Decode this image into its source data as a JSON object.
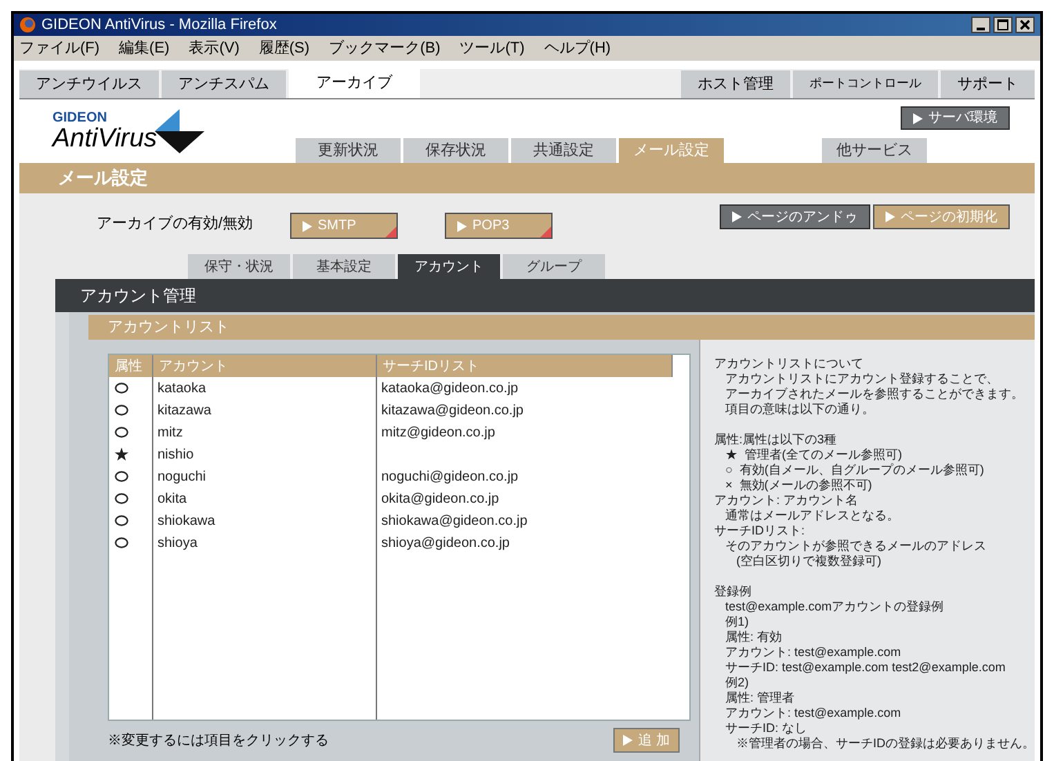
{
  "window": {
    "title": "GIDEON AntiVirus - Mozilla Firefox"
  },
  "menu": [
    "ファイル(F)",
    "編集(E)",
    "表示(V)",
    "履歴(S)",
    "ブックマーク(B)",
    "ツール(T)",
    "ヘルプ(H)"
  ],
  "top_tabs_left": [
    {
      "label": "アンチウイルス",
      "selected": false
    },
    {
      "label": "アンチスパム",
      "selected": false
    },
    {
      "label": "アーカイブ",
      "selected": true
    }
  ],
  "top_tabs_right": [
    {
      "label": "ホスト管理",
      "selected": false
    },
    {
      "label": "ポートコントロール",
      "selected": false
    },
    {
      "label": "サポート",
      "selected": false
    }
  ],
  "logo": {
    "brand": "GIDEON",
    "product": "AntiVirus"
  },
  "server_button": "サーバ環境",
  "nav_tabs": [
    {
      "label": "更新状況",
      "selected": false
    },
    {
      "label": "保存状況",
      "selected": false
    },
    {
      "label": "共通設定",
      "selected": false
    },
    {
      "label": "メール設定",
      "selected": true
    }
  ],
  "other_tab": {
    "label": "他サービス",
    "selected": false
  },
  "section_title": "メール設定",
  "archive_label": "アーカイブの有効/無効",
  "protocol_buttons": [
    "SMTP",
    "POP3"
  ],
  "page_buttons": [
    {
      "label": "ページのアンドゥ",
      "kind": "dark"
    },
    {
      "label": "ページの初期化",
      "kind": "tan"
    }
  ],
  "sub_tabs": [
    {
      "label": "保守・状況",
      "selected": false
    },
    {
      "label": "基本設定",
      "selected": false
    },
    {
      "label": "アカウント",
      "selected": true
    },
    {
      "label": "グループ",
      "selected": false
    }
  ],
  "panel_title": "アカウント管理",
  "list_title": "アカウントリスト",
  "table": {
    "columns": [
      "属性",
      "アカウント",
      "サーチIDリスト"
    ],
    "rows": [
      {
        "kind": "valid",
        "account": "kataoka",
        "search_id": "kataoka@gideon.co.jp"
      },
      {
        "kind": "valid",
        "account": "kitazawa",
        "search_id": "kitazawa@gideon.co.jp"
      },
      {
        "kind": "valid",
        "account": "mitz",
        "search_id": "mitz@gideon.co.jp"
      },
      {
        "kind": "admin",
        "account": "nishio"
      },
      {
        "kind": "valid",
        "account": "noguchi",
        "search_id": "noguchi@gideon.co.jp"
      },
      {
        "kind": "valid",
        "account": "okita",
        "search_id": "okita@gideon.co.jp"
      },
      {
        "kind": "valid",
        "account": "shiokawa",
        "search_id": "shiokawa@gideon.co.jp"
      },
      {
        "kind": "valid",
        "account": "shioya",
        "search_id": "shioya@gideon.co.jp"
      }
    ]
  },
  "note": "※変更するには項目をクリックする",
  "add_button": "追 加",
  "help": [
    [
      {
        "text": "アカウントリストについて",
        "children": [
          {
            "text": "アカウントリストにアカウント登録することで、"
          },
          {
            "text": "アーカイブされたメールを参照することができます。"
          },
          {
            "text": "項目の意味は以下の通り。"
          }
        ]
      }
    ],
    [
      {
        "text": "属性:属性は以下の3種",
        "children": [
          {
            "text": "★  管理者(全てのメール参照可)"
          },
          {
            "text": "○  有効(自メール、自グループのメール参照可)"
          },
          {
            "text": "×  無効(メールの参照不可)"
          }
        ]
      },
      {
        "text": "アカウント: アカウント名",
        "children": [
          {
            "text": "通常はメールアドレスとなる。"
          }
        ]
      },
      {
        "text": "サーチIDリスト:",
        "children": [
          {
            "text": "そのアカウントが参照できるメールのアドレス",
            "children": [
              {
                "text": "(空白区切りで複数登録可)"
              }
            ]
          }
        ]
      }
    ],
    [
      {
        "text": "登録例",
        "children": [
          {
            "text": "test@example.comアカウントの登録例"
          },
          {
            "text": "例1)"
          },
          {
            "text": "属性: 有効"
          },
          {
            "text": "アカウント: test@example.com"
          },
          {
            "text": "サーチID: test@example.com test2@example.com"
          },
          {
            "text": "例2)"
          },
          {
            "text": "属性: 管理者"
          },
          {
            "text": "アカウント: test@example.com"
          },
          {
            "text": "サーチID: なし",
            "children": [
              {
                "text": "※管理者の場合、サーチIDの登録は必要ありません。"
              }
            ]
          }
        ]
      }
    ]
  ]
}
